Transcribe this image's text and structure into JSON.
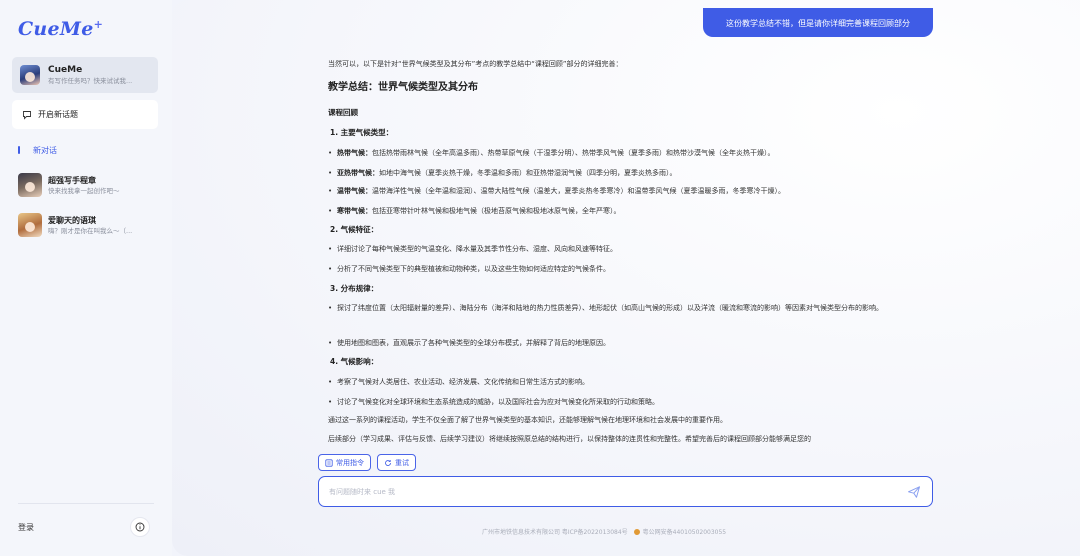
{
  "sidebar": {
    "logo": "CueMe",
    "logo_plus": "+",
    "bot": {
      "name": "CueMe",
      "subtitle": "有写作任务吗？快来试试我..."
    },
    "new_topic_label": "开启新话题",
    "new_chat_label": "新对话",
    "history": [
      {
        "title": "超强写手程章",
        "subtitle": "快来找我拿一起创作吧～"
      },
      {
        "title": "爱聊天的语琪",
        "subtitle": "嗨？刚才是你在叫我么～（..."
      }
    ],
    "login_label": "登录"
  },
  "chat": {
    "user_message": "这份教学总结不错，但是请你详细完善课程回顾部分",
    "intro": "当然可以，以下是针对“世界气候类型及其分布”考点的教学总结中“课程回顾”部分的详细完善：",
    "heading": "教学总结：世界气候类型及其分布",
    "subheading": "课程回顾",
    "n1": "1. 主要气候类型：",
    "b1_1": {
      "bold": "热带气候：",
      "text": "包括热带雨林气候（全年高温多雨）、热带草原气候（干湿季分明）、热带季风气候（夏季多雨）和热带沙漠气候（全年炎热干燥）。"
    },
    "b1_2": {
      "bold": "亚热带气候：",
      "text": "如地中海气候（夏季炎热干燥，冬季温和多雨）和亚热带湿润气候（四季分明，夏季炎热多雨）。"
    },
    "b1_3": {
      "bold": "温带气候：",
      "text": "温带海洋性气候（全年温和湿润）、温带大陆性气候（温差大，夏季炎热冬季寒冷）和温带季风气候（夏季温暖多雨，冬季寒冷干燥）。"
    },
    "b1_4": {
      "bold": "寒带气候：",
      "text": "包括亚寒带针叶林气候和极地气候（极地苔原气候和极地冰原气候，全年严寒）。"
    },
    "n2": "2. 气候特征：",
    "b2_1": "详细讨论了每种气候类型的气温变化、降水量及其季节性分布、湿度、风向和风速等特征。",
    "b2_2": "分析了不同气候类型下的典型植被和动物种类，以及这些生物如何适应特定的气候条件。",
    "n3": "3. 分布规律：",
    "b3_1": "探讨了纬度位置（太阳辐射量的差异）、海陆分布（海洋和陆地的热力性质差异）、地形起伏（如高山气候的形成）以及洋流（暖流和寒流的影响）等因素对气候类型分布的影响。",
    "b3_2": "使用地图和图表，直观展示了各种气候类型的全球分布模式，并解释了背后的地理原因。",
    "n4": "4. 气候影响：",
    "b4_1": "考察了气候对人类居住、农业活动、经济发展、文化传统和日常生活方式的影响。",
    "b4_2": "讨论了气候变化对全球环境和生态系统造成的威胁，以及国际社会为应对气候变化所采取的行动和策略。",
    "p1": "通过这一系列的课程活动，学生不仅全面了解了世界气候类型的基本知识，还能够理解气候在地理环境和社会发展中的重要作用。",
    "p2": "后续部分（学习成果、评估与反馈、后续学习建议）将继续按照原总结的结构进行，以保持整体的连贯性和完整性。希望完善后的课程回顾部分能够满足您的"
  },
  "tools": {
    "common_commands": "常用指令",
    "retry": "重试"
  },
  "input": {
    "placeholder": "有问题随时来 cue 我"
  },
  "footer": {
    "company": "广州市地铁信息技术有限公司 粤ICP备2022013084号",
    "police": "粤公网安备44010502003055"
  },
  "colors": {
    "accent": "#3f5ce6",
    "sidebar_bg": "#f4f6fb"
  },
  "icons": [
    "chat-plus-icon",
    "info-icon",
    "command-icon",
    "retry-icon",
    "send-icon",
    "police-badge-icon"
  ]
}
